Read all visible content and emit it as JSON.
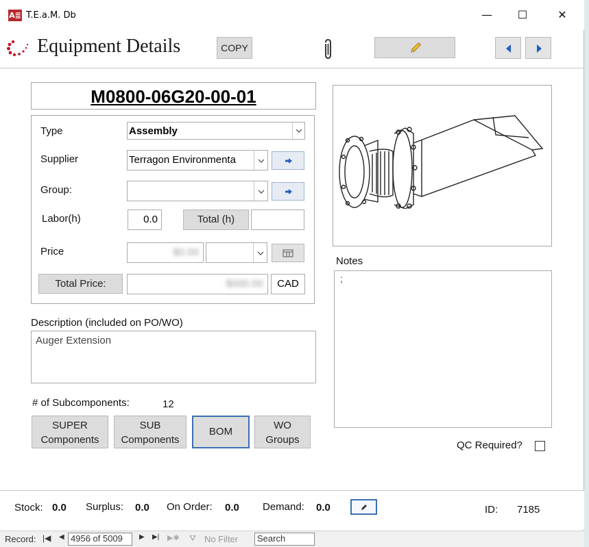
{
  "window": {
    "app_icon": "A≣",
    "title": "T.E.a.M. Db",
    "minimize": "—",
    "maximize": "☐",
    "close": "✕"
  },
  "header": {
    "title": "Equipment Details",
    "copy_label": "COPY",
    "icons": [
      "loading-dots-logo-icon",
      "paperclip-icon",
      "pencil-icon",
      "prev-arrow-icon",
      "next-arrow-icon"
    ]
  },
  "record": {
    "part_number": "M0800-06G20-00-01",
    "type_label": "Type",
    "type_value": "Assembly",
    "supplier_label": "Supplier",
    "supplier_value": "Terragon Environmenta",
    "group_label": "Group:",
    "group_value": "",
    "labor_label": "Labor(h)",
    "labor_value": "0.0",
    "total_h_label": "Total (h)",
    "total_h_value": "",
    "price_label": "Price",
    "price_value": "$0.00",
    "total_price_label": "Total Price:",
    "total_price_value": "$000.00",
    "currency": "CAD"
  },
  "description": {
    "label": "Description (included on PO/WO)",
    "value": "Auger Extension"
  },
  "notes": {
    "label": "Notes",
    "value": ";"
  },
  "subcomponents": {
    "label": "# of Subcomponents:",
    "count": "12",
    "super_line1": "SUPER",
    "super_line2": "Components",
    "sub_line1": "SUB",
    "sub_line2": "Components",
    "bom": "BOM",
    "wo_line1": "WO",
    "wo_line2": "Groups"
  },
  "qc": {
    "label": "QC Required?",
    "checked": false
  },
  "stock": {
    "stock_label": "Stock:",
    "stock_value": "0.0",
    "surplus_label": "Surplus:",
    "surplus_value": "0.0",
    "on_order_label": "On Order:",
    "on_order_value": "0.0",
    "demand_label": "Demand:",
    "demand_value": "0.0",
    "id_label": "ID:",
    "id_value": "7185"
  },
  "nav": {
    "record_label": "Record:",
    "position": "4956 of 5009",
    "no_filter": "No Filter",
    "search_placeholder": "Search"
  },
  "colors": {
    "accent_blue": "#1f5fbf",
    "logo_red": "#c0192b",
    "button_gray": "#dcdcdc"
  }
}
